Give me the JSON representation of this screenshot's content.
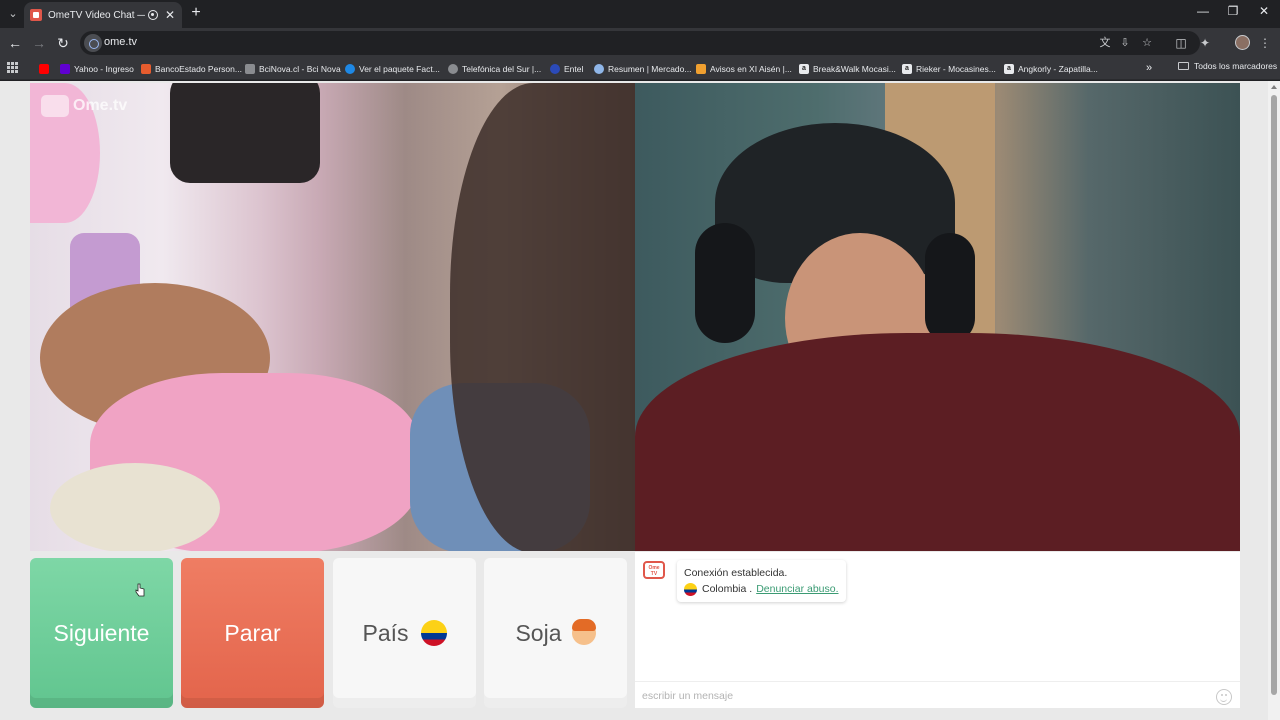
{
  "browser": {
    "tab": {
      "title": "OmeTV Video Chat — Alte"
    },
    "url": "ome.tv",
    "bookmarks": [
      {
        "label": "",
        "icon": "youtube-icon",
        "color": "#ff0000"
      },
      {
        "label": "Yahoo - Ingreso",
        "icon": "yahoo-icon",
        "color": "#6001d2"
      },
      {
        "label": "BancoEstado Person...",
        "icon": "bancoestado-icon",
        "color": "#e65c2e"
      },
      {
        "label": "BciNova.cl - Bci Nova",
        "icon": "page-icon",
        "color": "#8a8c90"
      },
      {
        "label": "Ver el paquete Fact...",
        "icon": "globe-icon",
        "color": "#1e88e5"
      },
      {
        "label": "Telefónica del Sur |...",
        "icon": "globe-icon",
        "color": "#8a8c90"
      },
      {
        "label": "Entel",
        "icon": "entel-icon",
        "color": "#2b4ab8"
      },
      {
        "label": "Resumen | Mercado...",
        "icon": "mercadolibre-icon",
        "color": "#8fb6e8"
      },
      {
        "label": "Avisos en XI Aisén |...",
        "icon": "avisos-icon",
        "color": "#f0a030"
      },
      {
        "label": "Break&Walk Mocasi...",
        "icon": "amazon-icon",
        "color": "#e8eaed"
      },
      {
        "label": "Rieker - Mocasines...",
        "icon": "amazon-icon",
        "color": "#e8eaed"
      },
      {
        "label": "Angkorly - Zapatilla...",
        "icon": "amazon-icon",
        "color": "#e8eaed"
      }
    ],
    "all_bookmarks": "Todos los marcadores"
  },
  "app": {
    "watermark": "Ome.tv",
    "buttons": {
      "next": "Siguiente",
      "stop": "Parar",
      "country": "País",
      "gender": "Soja"
    },
    "chat": {
      "logo": "Ome TV",
      "status": "Conexión establecida.",
      "country": "Colombia .",
      "report": "Denunciar abuso.",
      "input_placeholder": "escribir un mensaje"
    }
  },
  "colors": {
    "next": "#6fcf9b",
    "stop": "#e86f55",
    "accent_link": "#3a9b73"
  }
}
